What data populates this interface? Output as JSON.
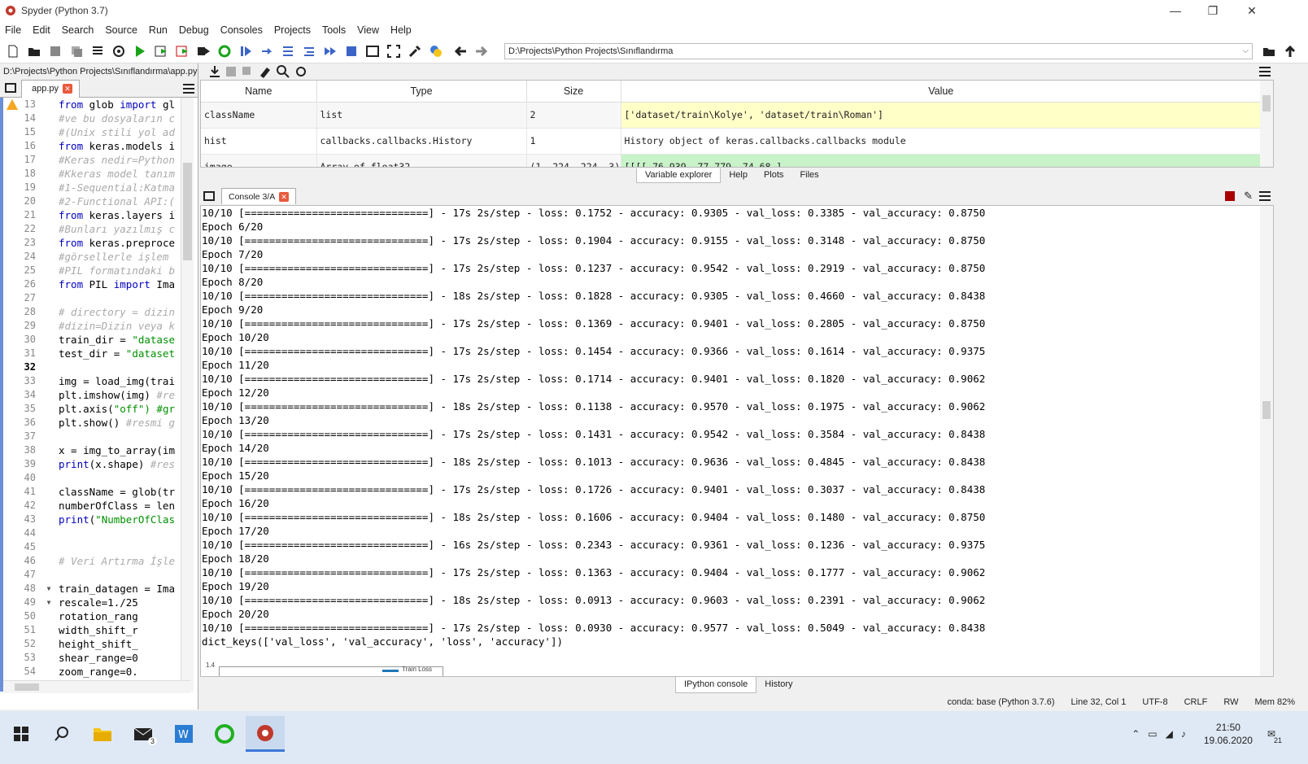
{
  "window": {
    "title": "Spyder (Python 3.7)"
  },
  "menu": [
    "File",
    "Edit",
    "Search",
    "Source",
    "Run",
    "Debug",
    "Consoles",
    "Projects",
    "Tools",
    "View",
    "Help"
  ],
  "toolbar": {
    "working_dir": "D:\\Projects\\Python Projects\\Sınıflandırma"
  },
  "editor": {
    "path": "D:\\Projects\\Python Projects\\Sınıflandırma\\app.py",
    "tab": "app.py",
    "lines": [
      {
        "n": "13",
        "t": "from glob import gl"
      },
      {
        "n": "14",
        "t": "#ve bu dosyaların c"
      },
      {
        "n": "15",
        "t": "#(Unix stili yol ad"
      },
      {
        "n": "16",
        "t": "from keras.models i"
      },
      {
        "n": "17",
        "t": "#Keras nedir=Python"
      },
      {
        "n": "18",
        "t": "#Kkeras model tanım"
      },
      {
        "n": "19",
        "t": "#1-Sequential:Katma"
      },
      {
        "n": "20",
        "t": "#2-Functional API:("
      },
      {
        "n": "21",
        "t": "from keras.layers i"
      },
      {
        "n": "22",
        "t": "#Bunları yazılmış c"
      },
      {
        "n": "23",
        "t": "from keras.preproce"
      },
      {
        "n": "24",
        "t": "#görsellerle işlem"
      },
      {
        "n": "25",
        "t": "#PIL formatındaki b"
      },
      {
        "n": "26",
        "t": "from PIL import Ima"
      },
      {
        "n": "27",
        "t": ""
      },
      {
        "n": "28",
        "t": "# directory = dizin"
      },
      {
        "n": "29",
        "t": "#dizin=Dizin veya k"
      },
      {
        "n": "30",
        "t": "train_dir = \"datase"
      },
      {
        "n": "31",
        "t": "test_dir = \"dataset"
      },
      {
        "n": "32",
        "t": ""
      },
      {
        "n": "33",
        "t": "img = load_img(trai"
      },
      {
        "n": "34",
        "t": "plt.imshow(img) #re"
      },
      {
        "n": "35",
        "t": "plt.axis(\"off\") #gr"
      },
      {
        "n": "36",
        "t": "plt.show() #resmi g"
      },
      {
        "n": "37",
        "t": ""
      },
      {
        "n": "38",
        "t": "x = img_to_array(im"
      },
      {
        "n": "39",
        "t": "print(x.shape) #res"
      },
      {
        "n": "40",
        "t": ""
      },
      {
        "n": "41",
        "t": "className = glob(tr"
      },
      {
        "n": "42",
        "t": "numberOfClass = len"
      },
      {
        "n": "43",
        "t": "print(\"NumberOfClas"
      },
      {
        "n": "44",
        "t": ""
      },
      {
        "n": "45",
        "t": ""
      },
      {
        "n": "46",
        "t": "# Veri Artırma İşle"
      },
      {
        "n": "47",
        "t": ""
      },
      {
        "n": "48",
        "t": "train_datagen = Ima"
      },
      {
        "n": "49",
        "t": "    rescale=1./25"
      },
      {
        "n": "50",
        "t": "    rotation_rang"
      },
      {
        "n": "51",
        "t": "    width_shift_r"
      },
      {
        "n": "52",
        "t": "    height_shift_"
      },
      {
        "n": "53",
        "t": "    shear_range=0"
      },
      {
        "n": "54",
        "t": "    zoom_range=0."
      }
    ]
  },
  "variables": {
    "headers": [
      "Name",
      "Type",
      "Size",
      "Value"
    ],
    "rows": [
      {
        "name": "className",
        "type": "list",
        "size": "2",
        "value": "['dataset/train\\Kolye', 'dataset/train\\Roman']"
      },
      {
        "name": "hist",
        "type": "callbacks.callbacks.History",
        "size": "1",
        "value": "History object of keras.callbacks.callbacks module"
      },
      {
        "name": "image",
        "type": "Array of float32",
        "size": "(1, 224, 224, 3)",
        "value": "[[[[-76.939     -77.779     -74.68      ]"
      }
    ],
    "tabs": [
      "Variable explorer",
      "Help",
      "Plots",
      "Files"
    ]
  },
  "console": {
    "tab": "Console 3/A",
    "lines": [
      "10/10 [==============================] - 17s 2s/step - loss: 0.1752 - accuracy: 0.9305 - val_loss: 0.3385 - val_accuracy: 0.8750",
      "Epoch 6/20",
      "10/10 [==============================] - 17s 2s/step - loss: 0.1904 - accuracy: 0.9155 - val_loss: 0.3148 - val_accuracy: 0.8750",
      "Epoch 7/20",
      "10/10 [==============================] - 17s 2s/step - loss: 0.1237 - accuracy: 0.9542 - val_loss: 0.2919 - val_accuracy: 0.8750",
      "Epoch 8/20",
      "10/10 [==============================] - 18s 2s/step - loss: 0.1828 - accuracy: 0.9305 - val_loss: 0.4660 - val_accuracy: 0.8438",
      "Epoch 9/20",
      "10/10 [==============================] - 17s 2s/step - loss: 0.1369 - accuracy: 0.9401 - val_loss: 0.2805 - val_accuracy: 0.8750",
      "Epoch 10/20",
      "10/10 [==============================] - 17s 2s/step - loss: 0.1454 - accuracy: 0.9366 - val_loss: 0.1614 - val_accuracy: 0.9375",
      "Epoch 11/20",
      "10/10 [==============================] - 17s 2s/step - loss: 0.1714 - accuracy: 0.9401 - val_loss: 0.1820 - val_accuracy: 0.9062",
      "Epoch 12/20",
      "10/10 [==============================] - 18s 2s/step - loss: 0.1138 - accuracy: 0.9570 - val_loss: 0.1975 - val_accuracy: 0.9062",
      "Epoch 13/20",
      "10/10 [==============================] - 17s 2s/step - loss: 0.1431 - accuracy: 0.9542 - val_loss: 0.3584 - val_accuracy: 0.8438",
      "Epoch 14/20",
      "10/10 [==============================] - 18s 2s/step - loss: 0.1013 - accuracy: 0.9636 - val_loss: 0.4845 - val_accuracy: 0.8438",
      "Epoch 15/20",
      "10/10 [==============================] - 17s 2s/step - loss: 0.1726 - accuracy: 0.9401 - val_loss: 0.3037 - val_accuracy: 0.8438",
      "Epoch 16/20",
      "10/10 [==============================] - 18s 2s/step - loss: 0.1606 - accuracy: 0.9404 - val_loss: 0.1480 - val_accuracy: 0.8750",
      "Epoch 17/20",
      "10/10 [==============================] - 16s 2s/step - loss: 0.2343 - accuracy: 0.9361 - val_loss: 0.1236 - val_accuracy: 0.9375",
      "Epoch 18/20",
      "10/10 [==============================] - 17s 2s/step - loss: 0.1363 - accuracy: 0.9404 - val_loss: 0.1777 - val_accuracy: 0.9062",
      "Epoch 19/20",
      "10/10 [==============================] - 18s 2s/step - loss: 0.0913 - accuracy: 0.9603 - val_loss: 0.2391 - val_accuracy: 0.9062",
      "Epoch 20/20",
      "10/10 [==============================] - 17s 2s/step - loss: 0.0930 - accuracy: 0.9577 - val_loss: 0.5049 - val_accuracy: 0.8438",
      "dict_keys(['val_loss', 'val_accuracy', 'loss', 'accuracy'])"
    ],
    "plot_tick": "1.4",
    "plot_legend": "Train Loss",
    "tabs": [
      "IPython console",
      "History"
    ]
  },
  "status": {
    "conda": "conda: base (Python 3.7.6)",
    "position": "Line 32, Col 1",
    "encoding": "UTF-8",
    "eol": "CRLF",
    "rw": "RW",
    "mem": "Mem 82%"
  },
  "taskbar": {
    "time": "21:50",
    "date": "19.06.2020",
    "notif_count": "21",
    "mail_badge": "3"
  },
  "colors": {
    "keyword": "#0000c0",
    "comment": "#aaaaaa",
    "string": "#009000",
    "highlight_yellow": "#ffffc8",
    "highlight_green": "#c8f2c8"
  }
}
